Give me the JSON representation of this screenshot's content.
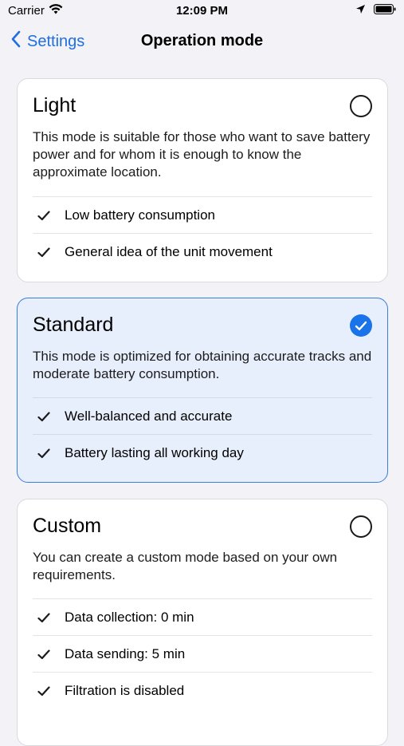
{
  "status_bar": {
    "carrier": "Carrier",
    "time": "12:09 PM"
  },
  "nav": {
    "back_label": "Settings",
    "title": "Operation mode"
  },
  "modes": [
    {
      "title": "Light",
      "selected": false,
      "description": "This mode is suitable for those who want to save battery power and for whom it is enough to know the approximate location.",
      "features": [
        "Low battery consumption",
        "General idea of the unit movement"
      ]
    },
    {
      "title": "Standard",
      "selected": true,
      "description": "This mode is optimized for obtaining accurate tracks and moderate battery consumption.",
      "features": [
        "Well-balanced and accurate",
        "Battery lasting all working day"
      ]
    },
    {
      "title": "Custom",
      "selected": false,
      "description": "You can create a custom mode based on your own requirements.",
      "features": [
        "Data collection: 0 min",
        "Data sending: 5 min",
        "Filtration is disabled"
      ]
    }
  ],
  "colors": {
    "accent": "#1a73e8",
    "link": "#1f6fe0",
    "selected_bg": "#e8effc",
    "selected_border": "#3b7ce0"
  }
}
